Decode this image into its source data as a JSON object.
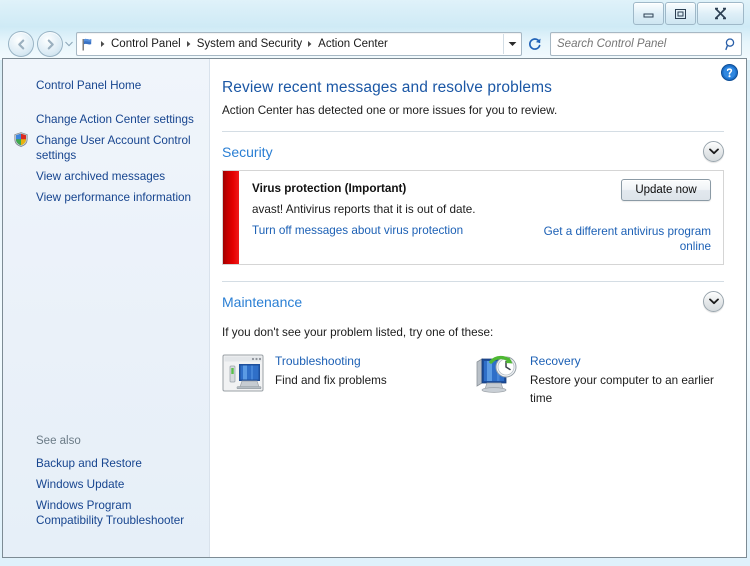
{
  "window": {
    "controls": {
      "minimize_label": "Minimize",
      "maximize_label": "Maximize",
      "close_label": "Close"
    }
  },
  "navbar": {
    "back_label": "Back",
    "forward_label": "Forward",
    "recent_pages_label": "Recent pages",
    "address_icon": "control-panel-flag-icon",
    "breadcrumbs": [
      "Control Panel",
      "System and Security",
      "Action Center"
    ],
    "dropdown_label": "Previous locations",
    "refresh_label": "Refresh",
    "search": {
      "placeholder": "Search Control Panel",
      "value": ""
    }
  },
  "sidebar": {
    "items": [
      {
        "label": "Control Panel Home",
        "icon": null,
        "gap": false
      },
      {
        "label": "Change Action Center settings",
        "icon": null,
        "gap": true
      },
      {
        "label": "Change User Account Control settings",
        "icon": "uac-shield-icon",
        "gap": false
      },
      {
        "label": "View archived messages",
        "icon": null,
        "gap": false
      },
      {
        "label": "View performance information",
        "icon": null,
        "gap": false
      }
    ],
    "see_also": {
      "title": "See also",
      "items": [
        {
          "label": "Backup and Restore"
        },
        {
          "label": "Windows Update"
        },
        {
          "label": "Windows Program Compatibility Troubleshooter"
        }
      ]
    }
  },
  "main": {
    "help_label": "Help",
    "title": "Review recent messages and resolve problems",
    "subtitle": "Action Center has detected one or more issues for you to review.",
    "sections": [
      {
        "title": "Security",
        "expand_label": "Expand Security"
      },
      {
        "title": "Maintenance",
        "expand_label": "Expand Maintenance"
      }
    ],
    "alert": {
      "severity_color": "#e40000",
      "title": "Virus protection  (Important)",
      "description": "avast! Antivirus reports that it is out of date.",
      "link_left": "Turn off messages about virus protection",
      "link_right": "Get a different antivirus program online",
      "button_label": "Update now"
    },
    "try_text": "If you don't see your problem listed, try one of these:",
    "tasks": [
      {
        "icon": "troubleshooting-icon",
        "link": "Troubleshooting",
        "desc": "Find and fix problems"
      },
      {
        "icon": "recovery-icon",
        "link": "Recovery",
        "desc": "Restore your computer to an earlier time"
      }
    ]
  },
  "colors": {
    "accent_link": "#1c60b5",
    "section_heading": "#2a7fd4",
    "page_title": "#1b57a5",
    "alert_red": "#e40000",
    "sidebar_link": "#17458f"
  }
}
